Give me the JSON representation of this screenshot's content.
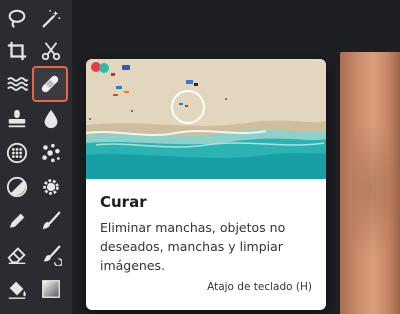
{
  "colors": {
    "toolbar_bg": "#2a2c31",
    "icon": "#e6e6e6",
    "active_border": "#e8673f",
    "tooltip_bg": "#ffffff"
  },
  "toolbar": {
    "tools": [
      {
        "name": "lasso-tool",
        "icon": "lasso-icon"
      },
      {
        "name": "magic-wand-tool",
        "icon": "magic-wand-icon"
      },
      {
        "name": "crop-tool",
        "icon": "crop-icon"
      },
      {
        "name": "cut-tool",
        "icon": "scissors-icon"
      },
      {
        "name": "liquify-tool",
        "icon": "waves-icon"
      },
      {
        "name": "heal-tool",
        "icon": "bandage-icon",
        "active": true
      },
      {
        "name": "clone-stamp-tool",
        "icon": "stamp-icon"
      },
      {
        "name": "blur-tool",
        "icon": "drop-icon"
      },
      {
        "name": "pattern-tool",
        "icon": "grid-circle-icon"
      },
      {
        "name": "spot-tool",
        "icon": "dots-icon"
      },
      {
        "name": "dodge-tool",
        "icon": "half-circle-icon"
      },
      {
        "name": "sponge-tool",
        "icon": "gear-icon"
      },
      {
        "name": "pen-tool",
        "icon": "pen-icon"
      },
      {
        "name": "brush-tool",
        "icon": "brush-icon"
      },
      {
        "name": "eraser-tool",
        "icon": "eraser-icon"
      },
      {
        "name": "color-replace-tool",
        "icon": "brush-replace-icon"
      },
      {
        "name": "fill-tool",
        "icon": "bucket-icon"
      },
      {
        "name": "gradient-tool",
        "icon": "gradient-icon"
      }
    ]
  },
  "tooltip": {
    "title": "Curar",
    "description": "Eliminar manchas, objetos no deseados, manchas y limpiar imágenes.",
    "shortcut": "Atajo de teclado (H)"
  }
}
